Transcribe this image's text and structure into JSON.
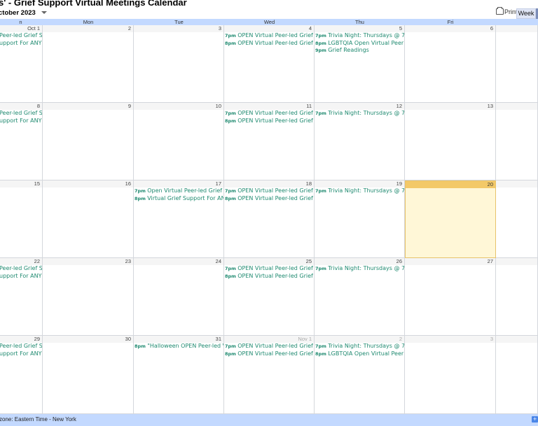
{
  "header": {
    "title": "s' - Grief Support Virtual Meetings Calendar",
    "month_label": "ctober 2023",
    "print_label": "Print",
    "view_label": "Week"
  },
  "day_headers": [
    "n",
    "Mon",
    "Tue",
    "Wed",
    "Thu",
    "Fri",
    ""
  ],
  "weeks": [
    {
      "days": [
        {
          "date": "Oct 1",
          "events": [
            {
              "time": "",
              "title": "Peer-led Grief S"
            },
            {
              "time": "",
              "title": "upport For ANY"
            }
          ]
        },
        {
          "date": "2",
          "events": []
        },
        {
          "date": "3",
          "events": []
        },
        {
          "date": "4",
          "events": [
            {
              "time": "7pm",
              "title": "OPEN Virtual Peer-led Grief S"
            },
            {
              "time": "8pm",
              "title": "OPEN Virtual Peer-led Grief S"
            }
          ]
        },
        {
          "date": "5",
          "events": [
            {
              "time": "7pm",
              "title": "Trivia Night: Thursdays @ 7P"
            },
            {
              "time": "8pm",
              "title": "LGBTQIA Open Virtual Peerle"
            },
            {
              "time": "9pm",
              "title": "Grief Readings"
            }
          ]
        },
        {
          "date": "6",
          "events": []
        },
        {
          "date": "",
          "events": []
        }
      ]
    },
    {
      "days": [
        {
          "date": "8",
          "events": [
            {
              "time": "",
              "title": "Peer-led Grief S"
            },
            {
              "time": "",
              "title": "upport For ANY"
            }
          ]
        },
        {
          "date": "9",
          "events": []
        },
        {
          "date": "10",
          "events": []
        },
        {
          "date": "11",
          "events": [
            {
              "time": "7pm",
              "title": "OPEN Virtual Peer-led Grief S"
            },
            {
              "time": "8pm",
              "title": "OPEN Virtual Peer-led Grief S"
            }
          ]
        },
        {
          "date": "12",
          "events": [
            {
              "time": "7pm",
              "title": "Trivia Night: Thursdays @ 7P"
            }
          ]
        },
        {
          "date": "13",
          "events": []
        },
        {
          "date": "",
          "events": []
        }
      ]
    },
    {
      "days": [
        {
          "date": "15",
          "events": []
        },
        {
          "date": "16",
          "events": []
        },
        {
          "date": "17",
          "events": [
            {
              "time": "7pm",
              "title": "Open Virtual Peer-led Grief S"
            },
            {
              "time": "8pm",
              "title": "Virtual Grief Support For ANY"
            }
          ]
        },
        {
          "date": "18",
          "events": [
            {
              "time": "7pm",
              "title": "OPEN Virtual Peer-led Grief S"
            },
            {
              "time": "8pm",
              "title": "OPEN Virtual Peer-led Grief S"
            }
          ]
        },
        {
          "date": "19",
          "events": [
            {
              "time": "7pm",
              "title": "Trivia Night: Thursdays @ 7P"
            }
          ]
        },
        {
          "date": "20",
          "events": []
        },
        {
          "date": "",
          "events": []
        }
      ]
    },
    {
      "days": [
        {
          "date": "22",
          "events": [
            {
              "time": "",
              "title": "Peer-led Grief S"
            },
            {
              "time": "",
              "title": "upport For ANY"
            }
          ]
        },
        {
          "date": "23",
          "events": []
        },
        {
          "date": "24",
          "events": []
        },
        {
          "date": "25",
          "events": [
            {
              "time": "7pm",
              "title": "OPEN Virtual Peer-led Grief S"
            },
            {
              "time": "8pm",
              "title": "OPEN Virtual Peer-led Grief S"
            }
          ]
        },
        {
          "date": "26",
          "events": [
            {
              "time": "7pm",
              "title": "Trivia Night: Thursdays @ 7P"
            }
          ]
        },
        {
          "date": "27",
          "events": []
        },
        {
          "date": "",
          "events": []
        }
      ]
    },
    {
      "days": [
        {
          "date": "29",
          "events": [
            {
              "time": "",
              "title": "Peer-led Grief S"
            },
            {
              "time": "",
              "title": "upport For ANY"
            }
          ]
        },
        {
          "date": "30",
          "events": []
        },
        {
          "date": "31",
          "events": [
            {
              "time": "8pm",
              "title": "\"Halloween OPEN Peer-led V"
            }
          ]
        },
        {
          "date": "Nov 1",
          "events": [
            {
              "time": "7pm",
              "title": "OPEN Virtual Peer-led Grief S"
            },
            {
              "time": "8pm",
              "title": "OPEN Virtual Peer-led Grief S"
            }
          ]
        },
        {
          "date": "2",
          "events": [
            {
              "time": "7pm",
              "title": "Trivia Night: Thursdays @ 7P"
            },
            {
              "time": "8pm",
              "title": "LGBTQIA Open Virtual Peerle"
            }
          ]
        },
        {
          "date": "3",
          "events": []
        },
        {
          "date": "",
          "events": []
        }
      ]
    }
  ],
  "today": {
    "week": 2,
    "day": 5
  },
  "other_month": [
    {
      "week": 4,
      "day": 3
    },
    {
      "week": 4,
      "day": 4
    },
    {
      "week": 4,
      "day": 5
    }
  ],
  "footer": {
    "timezone": "zone: Eastern Time - New York"
  },
  "colors": {
    "event": "#1f8a70",
    "header_bg": "#c3d9ff",
    "today_bg": "#fff7d7",
    "today_strip": "#f3c968"
  }
}
